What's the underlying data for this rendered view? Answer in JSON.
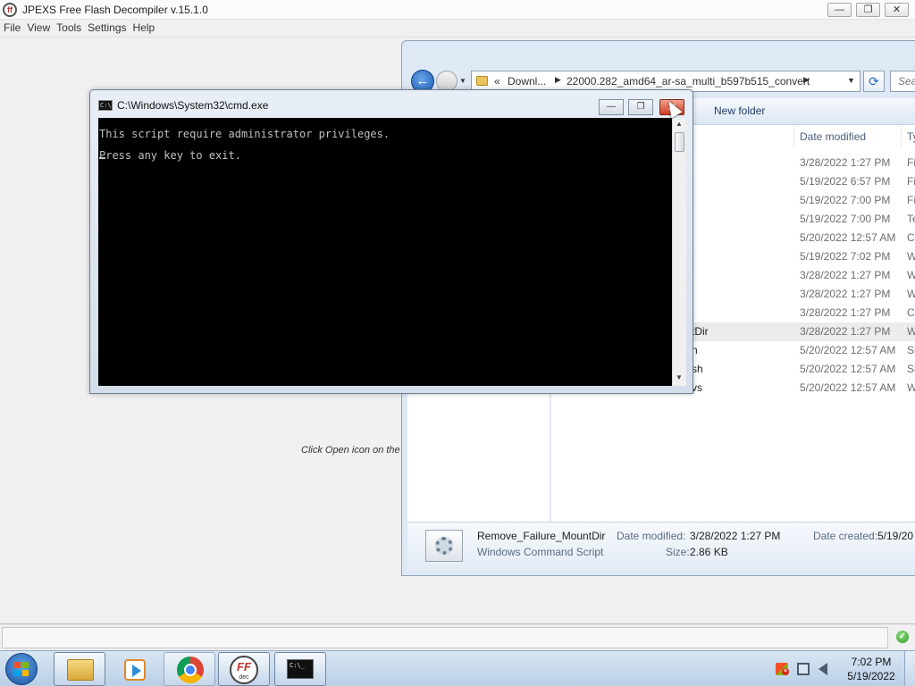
{
  "app": {
    "title": "JPEXS Free Flash Decompiler v.15.1.0",
    "icon_text": "ff",
    "controls": {
      "minimize": "—",
      "restore": "❐",
      "close": "✕"
    },
    "menu": [
      "File",
      "View",
      "Tools",
      "Settings",
      "Help"
    ],
    "hint_text": "Click Open icon on the t",
    "status_icon": "check-circle-icon"
  },
  "explorer": {
    "address": {
      "chevrons": "«",
      "segment_1": "Downl...",
      "segment_2": "22000.282_amd64_ar-sa_multi_b597b515_convert"
    },
    "search_placeholder": "Sea",
    "toolbar": {
      "new_folder": "New folder"
    },
    "columns": {
      "date": "Date modified",
      "type": "Ty"
    },
    "rows": [
      {
        "name": "",
        "date": "3/28/2022 1:27 PM",
        "type": "Fi"
      },
      {
        "name": "",
        "date": "5/19/2022 6:57 PM",
        "type": "Fi"
      },
      {
        "name": "",
        "date": "5/19/2022 7:00 PM",
        "type": "Fi"
      },
      {
        "name": "",
        "date": "5/19/2022 7:00 PM",
        "type": "Te"
      },
      {
        "name": "",
        "date": "5/20/2022 12:57 AM",
        "type": "C"
      },
      {
        "name": "",
        "date": "5/19/2022 7:02 PM",
        "type": "W"
      },
      {
        "name": "",
        "date": "3/28/2022 1:27 PM",
        "type": "W"
      },
      {
        "name": "",
        "date": "3/28/2022 1:27 PM",
        "type": "W"
      },
      {
        "name": "",
        "date": "3/28/2022 1:27 PM",
        "type": "C"
      },
      {
        "name": "tDir",
        "date": "3/28/2022 1:27 PM",
        "type": "W",
        "selected": true
      },
      {
        "name": "n",
        "date": "5/20/2022 12:57 AM",
        "type": "Sh"
      },
      {
        "name": "sh",
        "date": "5/20/2022 12:57 AM",
        "type": "Sh"
      },
      {
        "name": "vs",
        "date": "5/20/2022 12:57 AM",
        "type": "W"
      }
    ],
    "details": {
      "name": "Remove_Failure_MountDir",
      "type": "Windows Command Script",
      "modified_label": "Date modified:",
      "modified_value": "3/28/2022 1:27 PM",
      "size_label": "Size:",
      "size_value": "2.86 KB",
      "created_label": "Date created:",
      "created_value": "5/19/20"
    }
  },
  "cmd": {
    "title": "C:\\Windows\\System32\\cmd.exe",
    "icon_text": "C:\\",
    "lines": [
      "This script require administrator privileges.",
      "Press any key to exit."
    ],
    "controls": {
      "minimize": "—",
      "restore": "❐",
      "close": "✕"
    }
  },
  "taskbar": {
    "cmd_icon_text": "C:\\_",
    "ffdec_ff": "FF",
    "ffdec_dec": "dec",
    "clock_time": "7:02 PM",
    "clock_date": "5/19/2022"
  }
}
